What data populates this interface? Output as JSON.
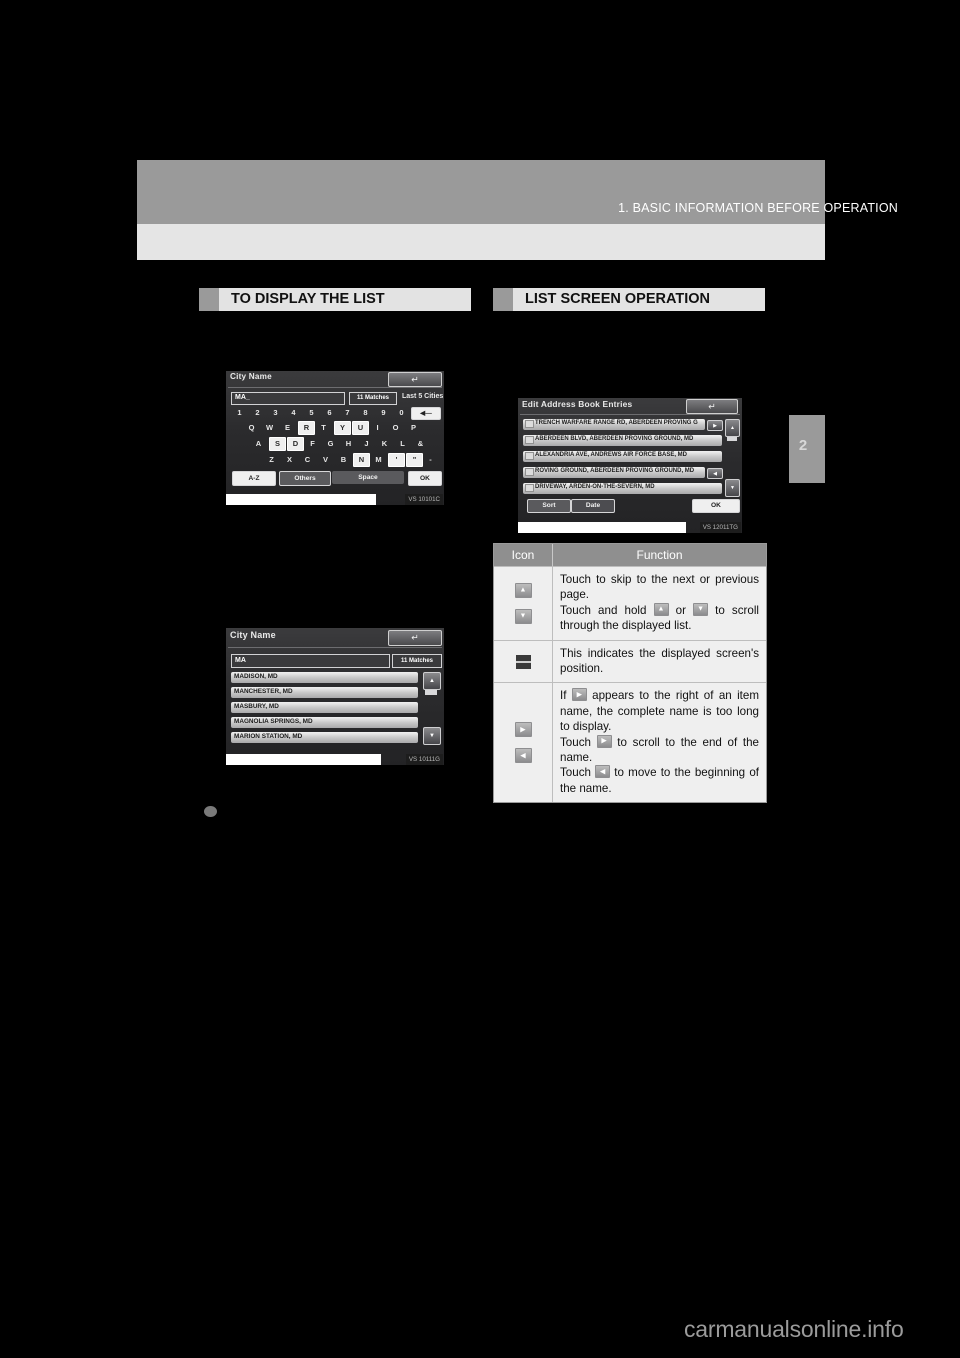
{
  "page": {
    "header_title": "1. BASIC INFORMATION BEFORE OPERATION",
    "page_number": "2",
    "watermark": "carmanualsonline.info"
  },
  "sections": {
    "left": {
      "title": "TO DISPLAY THE LIST"
    },
    "right": {
      "title": "LIST SCREEN OPERATION"
    }
  },
  "screenshot_keyboard": {
    "title": "City Name",
    "back_icon": "back-arrow-icon",
    "input_value": "MA_",
    "matches_chip": "11 Matches",
    "last_cities_label": "Last 5 Cities",
    "number_row": [
      "1",
      "2",
      "3",
      "4",
      "5",
      "6",
      "7",
      "8",
      "9",
      "0"
    ],
    "delete_key": "delete-backspace-icon",
    "row_q": [
      "Q",
      "W",
      "E",
      "R",
      "T",
      "Y",
      "U",
      "I",
      "O",
      "P"
    ],
    "row_a": [
      "A",
      "S",
      "D",
      "F",
      "G",
      "H",
      "J",
      "K",
      "L",
      "&"
    ],
    "row_z": [
      "Z",
      "X",
      "C",
      "V",
      "B",
      "N",
      "M",
      "'",
      "\"",
      "-"
    ],
    "highlighted_keys": [
      "R",
      "Y",
      "U",
      "S",
      "D",
      "N",
      "K",
      "L"
    ],
    "btn_az": "A-Z",
    "btn_other": "Others",
    "btn_space": "Space",
    "btn_ok": "OK",
    "caption_code": "VS 10101C"
  },
  "screenshot_list": {
    "title": "City Name",
    "back_icon": "back-arrow-icon",
    "input_value": "MA",
    "matches_chip": "11 Matches",
    "items": [
      "MADISON, MD",
      "MANCHESTER, MD",
      "MASBURY, MD",
      "MAGNOLIA SPRINGS, MD",
      "MARION STATION, MD"
    ],
    "scroll_up_icon": "page-up-icon",
    "scroll_down_icon": "page-down-icon",
    "caption_code": "VS 10111G"
  },
  "screenshot_address_book": {
    "title": "Edit Address Book Entries",
    "back_icon": "back-arrow-icon",
    "items": [
      "TRENCH WARFARE RANGE RD, ABERDEEN PROVING G",
      "ABERDEEN BLVD, ABERDEEN PROVING GROUND, MD",
      "ALEXANDRIA AVE, ANDREWS AIR FORCE BASE, MD",
      "ROVING GROUND, ABERDEEN PROVING GROUND, MD",
      "DRIVEWAY, ARDEN-ON-THE-SEVERN, MD"
    ],
    "row1_scroll_right_icon": "scroll-right-icon",
    "row4_scroll_left_icon": "scroll-left-icon",
    "btn_sort": "Sort",
    "btn_date": "Date",
    "btn_ok": "OK",
    "scroll_up_icon": "page-up-icon",
    "scroll_down_icon": "page-down-icon",
    "caption_code": "VS 12011TG"
  },
  "icon_table": {
    "header_icon": "Icon",
    "header_function": "Function",
    "rows": [
      {
        "icons": [
          "page-up-icon",
          "page-down-icon"
        ],
        "text_parts": [
          "Touch to skip to the next or previous page.",
          "Touch and hold ",
          " or ",
          " to scroll through the displayed list."
        ]
      },
      {
        "icons": [
          "screen-position-indicator-icon"
        ],
        "text_parts": [
          "This indicates the displayed screen's position."
        ]
      },
      {
        "icons": [
          "scroll-right-icon",
          "scroll-left-icon"
        ],
        "text_parts": [
          "If ",
          " appears to the right of an item name, the complete name is too long to display.",
          "Touch ",
          " to scroll to the end of the name.",
          "Touch ",
          " to move to the beginning of the name."
        ]
      }
    ]
  }
}
